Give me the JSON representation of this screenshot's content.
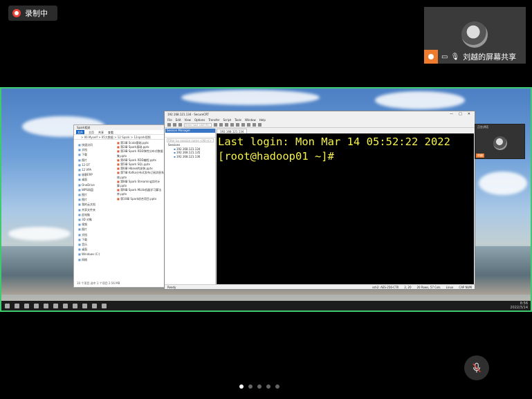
{
  "recording": {
    "label": "录制中",
    "color": "#e8433a"
  },
  "presenter": {
    "name": "刘越的屏幕共享",
    "host_color": "#ee7b2e"
  },
  "explorer": {
    "title": "Spark相关",
    "ribbon": [
      "文件",
      "主页",
      "共享",
      "查看"
    ],
    "path": "> 06 Myself > 05大数据 > 12 Spark > 12spark视频",
    "nav": [
      "快速访问",
      "文档",
      "下载",
      "图片",
      "12 OT",
      "12 VPA",
      "极客ERP",
      "桌面",
      "OneDrive",
      "WPS网盘",
      "图片",
      "图片",
      "我的云文档",
      "共享文件夹",
      "此电脑",
      "3D 对象",
      "视频",
      "图片",
      "文档",
      "下载",
      "音乐",
      "桌面",
      "Windows (C:)",
      "网络"
    ],
    "files": [
      "第1章 Scala基础.pptx",
      "第2章 Spark基础.pptx",
      "第3章 Spark RDD弹性分布式数据集.pptx",
      "第4章 Spark RDD编程.pptx",
      "第5章 Spark SQL.pptx",
      "第6章 Hbase的安装.pptx",
      "第7章 Kafka分布式发布订阅消息系统.pptx",
      "第8章 Spark Streaming实时计算.pptx",
      "第9章 Spark MLlib机器学习算法库.pptx",
      "第10章 Spark综合项目.pptx"
    ],
    "status": "10 个项目    选中 1 个项目  2.56 MB"
  },
  "crt": {
    "title": "192.168.121.134 - SecureCRT",
    "menu": [
      "File",
      "Edit",
      "View",
      "Options",
      "Transfer",
      "Script",
      "Tools",
      "Window",
      "Help"
    ],
    "host_placeholder": "Enter host <Alt+R>",
    "session_manager": {
      "title": "Session Manager",
      "filter_placeholder": "Filter by session name <Alt+I>",
      "folder": "Sessions",
      "sessions": [
        "192.168.121.134",
        "192.168.121.135",
        "192.168.121.136"
      ]
    },
    "tab": "192.168.121.134",
    "terminal_lines": [
      "Last login: Mon Mar 14 05:52:22 2022",
      "[root@hadoop01 ~]#"
    ],
    "status_left": "Ready",
    "status_items": [
      "ssh2: AES-256-CTR",
      "2, 20",
      "20 Rows, 57 Cols",
      "Linux",
      "CAP NUM"
    ]
  },
  "mini_tile": {
    "top_label": "正在讲话",
    "name": "刘越"
  },
  "taskbar": {
    "time": "8:56",
    "date": "2022/3/14"
  },
  "pager": {
    "count": 5,
    "active_index": 0
  }
}
